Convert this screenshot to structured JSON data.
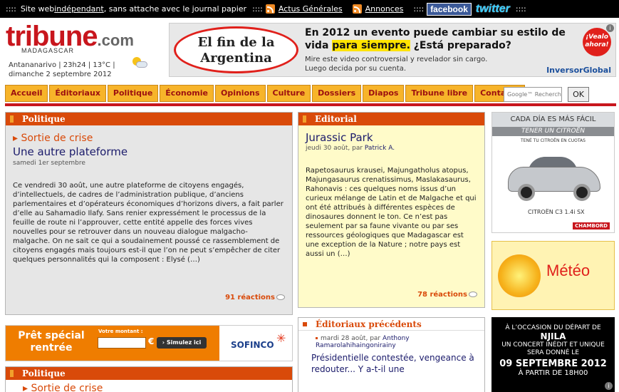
{
  "topbar": {
    "sep1": "::::",
    "text_before": "Site web ",
    "independant_link": "indépendant",
    "text_after": ", sans attache avec le journal papier",
    "sep2": "::::",
    "actus_link": "Actus Générales",
    "annonces_link": "Annonces",
    "sep3": "::::",
    "facebook": "facebook",
    "twitter": "twitter",
    "sep4": "::::"
  },
  "logo": {
    "word": "tribune",
    "tld": ".com",
    "country": "MADAGASCAR"
  },
  "weather": {
    "line": "Antananarivo | 23h24 | 13°C |",
    "date": "dimanche 2 septembre 2012",
    "icon": "partly-cloudy-icon"
  },
  "top_ad": {
    "oval_line1": "El fin de la",
    "oval_line2": "Argentina",
    "headline": "En 2012 un evento puede cambiar su estilo de vida ",
    "headline_mark": "para siempre.",
    "headline_tail": " ¿Está preparado?",
    "line1": "Mire este video controversial y revelador sin cargo.",
    "line2": "Luego decida por su cuenta.",
    "badge_line1": "¡Vealo",
    "badge_line2": "ahora!",
    "brand": "InversorGlobal",
    "info": "i"
  },
  "nav": {
    "tabs": [
      "Accueil",
      "Éditoriaux",
      "Politique",
      "Économie",
      "Opinions",
      "Culture",
      "Dossiers",
      "Diapos",
      "Tribune libre",
      "Contacts"
    ]
  },
  "search": {
    "placeholder": "Google™ Recherch",
    "ok": "OK"
  },
  "politique": {
    "head": "Politique",
    "subtitle": "Sortie de crise",
    "title": "Une autre plateforme",
    "date": "samedi 1er septembre",
    "body": "Ce vendredi 30 août, une autre plateforme de citoyens engagés, d’intellectuels, de cadres de l’administration publique, d’anciens parlementaires et d’opérateurs économiques d’horizons divers, a fait parler d’elle au Sahamadio Ilafy. Sans renier expressément le processus de la feuille de route ni l’approuver, cette entité appelle des forces vives nouvelles pour se retrouver dans un nouveau dialogue malgacho-malgache. On ne sait ce qui a soudainement poussé ce rassemblement de citoyens engagés mais toujours est-il que l’on ne peut s’empêcher de citer quelques personnalités qui la composent : Elysé (…)",
    "reactions": "91 réactions"
  },
  "editorial": {
    "head": "Editorial",
    "title": "Jurassic Park",
    "date": "jeudi 30 août, par ",
    "author": "Patrick A.",
    "body": "Rapetosaurus krausei, Majungatholus atopus, Majungasaurus crenatissimus, Maslakasaurus, Rahonavis : ces quelques noms issus d’un curieux mélange de Latin et de Malgache et qui ont été attribués à différentes espèces de dinosaures donnent le ton. Ce n’est pas seulement par sa faune vivante ou par ses ressources géologiques que Madagascar est une exception de la Nature ; notre pays est aussi un (…)",
    "reactions": "78 réactions"
  },
  "previous": {
    "head": "Éditoriaux précédents",
    "date": "mardi 28 août, par ",
    "author": "Anthony Ramarolahihaingonirainy",
    "title": "Présidentielle contestée, vengeance à redouter... Y a-t-il une"
  },
  "loan_ad": {
    "title_line1": "Prêt spécial",
    "title_line2": "rentrée",
    "label": "Votre montant :",
    "currency": "€",
    "button": "Simulez ici",
    "brand": "SOFINCO"
  },
  "politique2": {
    "head": "Politique",
    "subtitle": "Sortie de crise"
  },
  "citroen_ad": {
    "top": "CADA DÍA ES MÁS FÁCIL",
    "band": "TENER UN CITROËN",
    "small": "TENÉ TU CITROËN EN CUOTAS",
    "model": "CITROËN C3 1.4i SX",
    "dealer": "CHAMBORD"
  },
  "meteo_ad": {
    "label": "Météo"
  },
  "concert_ad": {
    "line1": "À L’OCCASION DU DÉPART DE",
    "name": "NJILA",
    "line2": "UN CONCERT INÉDIT ET UNIQUE",
    "line3": "SERA DONNÉ LE",
    "date": "09 SEPTEMBRE 2012",
    "time": "À PARTIR DE 18H00",
    "info": "i"
  }
}
